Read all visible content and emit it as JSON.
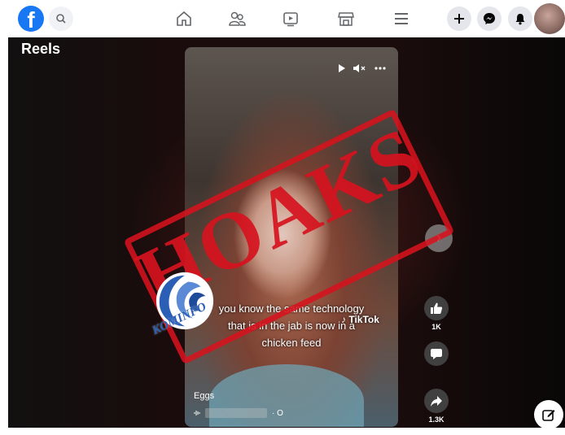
{
  "topbar": {
    "logo_letter": "f",
    "nav": [
      "home-icon",
      "friends-icon",
      "watch-icon",
      "marketplace-icon",
      "menu-icon"
    ],
    "actions": [
      "create-icon",
      "messenger-icon",
      "notifications-icon"
    ]
  },
  "reels": {
    "title": "Reels",
    "caption_lines": [
      "you know the same technology",
      "that is in the jab is now in a",
      "chicken feed"
    ],
    "watermark": "TikTok",
    "audio_label": "Eggs",
    "audio_suffix": "· O",
    "like_count": "1K",
    "share_count": "1.3K",
    "next_glyph": "›"
  },
  "overlay": {
    "stamp_text": "HOAKS",
    "logo_text": "KOMINFO",
    "stamp_color": "#d6121e",
    "logo_color": "#2a5fb5"
  },
  "colors": {
    "brand": "#1877f2",
    "background": "#0a0708"
  }
}
